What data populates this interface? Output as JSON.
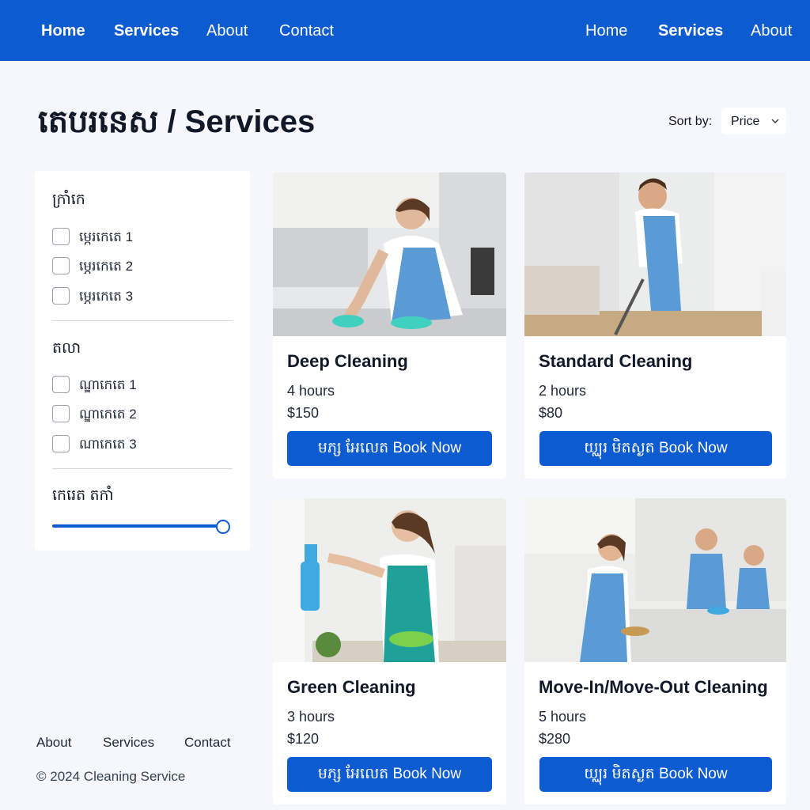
{
  "topnav": {
    "left": [
      "Home",
      "Services",
      "About",
      "Contact"
    ],
    "right": [
      "Home",
      "Services",
      "About"
    ]
  },
  "page": {
    "title": "តេបរនេស / Services",
    "sort_label": "Sort by:",
    "sort_value": "Price"
  },
  "filters": {
    "group1_title": "ក្រាំកេ",
    "group1_options": [
      "ម្ភេរកេតេ 1",
      "ម្ភេរកេតេ 2",
      "ម្ភេរកេតេ 3"
    ],
    "group2_title": "តលា",
    "group2_options": [
      "ណ្ឌាកេតេ 1",
      "ណ្ឌាកេតេ 2",
      "ណាកេតេ 3"
    ],
    "group3_title": "កេរេត តកាំ",
    "price_slider_value": 1.0
  },
  "cards": [
    {
      "title": "Deep Cleaning",
      "duration": "4 hours",
      "price": "$150",
      "button": "មភ្ស អែលេត  Book Now"
    },
    {
      "title": "Standard Cleaning",
      "duration": "2 hours",
      "price": "$80",
      "button": "យ្ឈុរ មិតស្ងត   Book Now"
    },
    {
      "title": "Green Cleaning",
      "duration": "3 hours",
      "price": "$120",
      "button": "មភ្ស អែលេត  Book Now"
    },
    {
      "title": "Move-In/Move-Out Cleaning",
      "duration": "5 hours",
      "price": "$280",
      "button": "យ្ឈុរ មិតស្ងត   Book Now"
    }
  ],
  "footer": {
    "links": [
      "About",
      "Services",
      "Contact"
    ],
    "copyright": "© 2024 Cleaning Service"
  },
  "colors": {
    "brand": "#0d5bd0",
    "background": "#f5f7fc"
  }
}
